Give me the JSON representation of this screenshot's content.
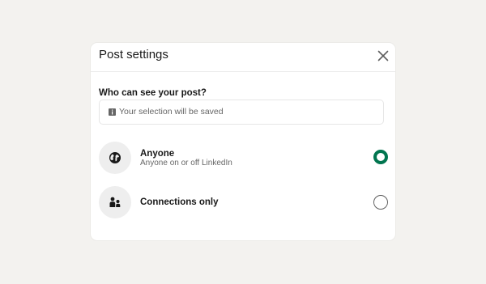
{
  "modal": {
    "title": "Post settings",
    "close_icon": "close-icon"
  },
  "visibility": {
    "label": "Who can see your post?",
    "notice_icon": "info-icon",
    "notice_text": "Your selection will be saved",
    "options": [
      {
        "title": "Anyone",
        "subtitle": "Anyone on or off LinkedIn",
        "icon": "globe-icon",
        "selected": true
      },
      {
        "title": "Connections only",
        "subtitle": "",
        "icon": "people-icon",
        "selected": false
      }
    ]
  },
  "colors": {
    "accent": "#01754f",
    "page_background": "#f3f2ef",
    "icon_circle": "#eeeeee"
  }
}
